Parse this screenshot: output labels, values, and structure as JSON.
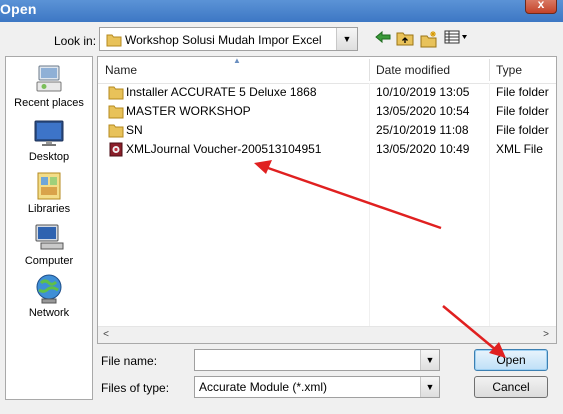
{
  "window": {
    "title": "Open",
    "close_label": "x"
  },
  "lookin": {
    "label": "Look in:",
    "value": "Workshop Solusi Mudah Impor Excel"
  },
  "places": [
    {
      "label": "Recent places",
      "icon": "recent-places-icon"
    },
    {
      "label": "Desktop",
      "icon": "desktop-icon"
    },
    {
      "label": "Libraries",
      "icon": "libraries-icon"
    },
    {
      "label": "Computer",
      "icon": "computer-icon"
    },
    {
      "label": "Network",
      "icon": "network-icon"
    }
  ],
  "columns": {
    "name": "Name",
    "date": "Date modified",
    "type": "Type"
  },
  "files": [
    {
      "name": "Installer ACCURATE 5 Deluxe 1868",
      "date": "10/10/2019 13:05",
      "type": "File folder",
      "icon": "folder-icon"
    },
    {
      "name": "MASTER WORKSHOP",
      "date": "13/05/2020 10:54",
      "type": "File folder",
      "icon": "folder-icon"
    },
    {
      "name": "SN",
      "date": "25/10/2019 11:08",
      "type": "File folder",
      "icon": "folder-icon"
    },
    {
      "name": "XMLJournal Voucher-200513104951",
      "date": "13/05/2020 10:49",
      "type": "XML File",
      "icon": "xml-file-icon"
    }
  ],
  "filename": {
    "label": "File name:",
    "value": ""
  },
  "filetype": {
    "label": "Files of type:",
    "value": "Accurate Module (*.xml)"
  },
  "buttons": {
    "open": "Open",
    "cancel": "Cancel"
  },
  "colors": {
    "titlebar": "#3d77c4",
    "annotation_arrow": "#e02020",
    "folder": "#e8c25a"
  }
}
